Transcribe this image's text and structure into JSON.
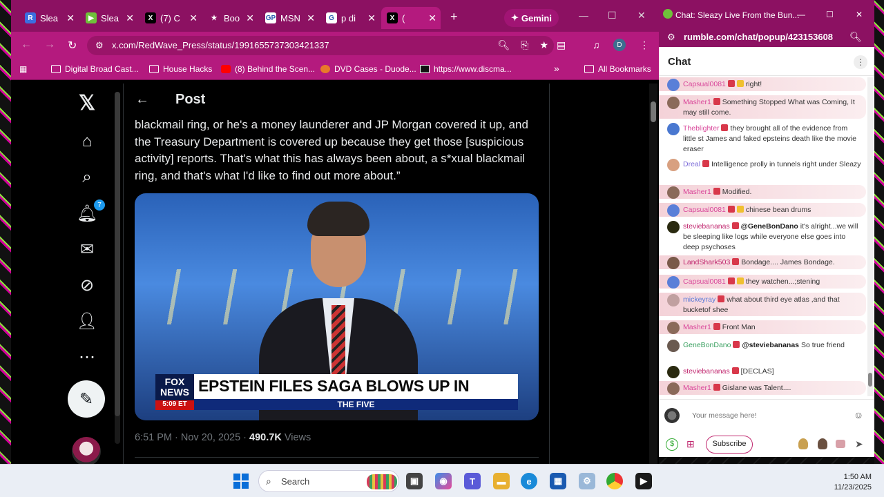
{
  "browser": {
    "tabs": [
      {
        "label": "Slea",
        "icon": "R",
        "color": "#3b6fe0"
      },
      {
        "label": "Slea",
        "icon": "▶",
        "color": "#6fc13a"
      },
      {
        "label": "(7) C",
        "icon": "X",
        "color": "#000000"
      },
      {
        "label": "Boo",
        "icon": "★",
        "color": "transparent"
      },
      {
        "label": "MSN",
        "icon": "GP",
        "color": "#ffffff"
      },
      {
        "label": "p di",
        "icon": "G",
        "color": "#ffffff"
      },
      {
        "label": "(",
        "icon": "X",
        "color": "#000000"
      }
    ],
    "new_tab": "+",
    "gemini_label": "Gemini",
    "url": "x.com/RedWave_Press/status/1991655737303421337",
    "profile_initial": "D",
    "bookmarks": [
      {
        "label": "Digital Broad Cast..."
      },
      {
        "label": "House Hacks"
      },
      {
        "label": "(8) Behind the Scen..."
      },
      {
        "label": "DVD Cases - Duode..."
      },
      {
        "label": "https://www.discma..."
      }
    ],
    "more_bookmarks": "»",
    "all_bookmarks": "All Bookmarks"
  },
  "xpost": {
    "header": "Post",
    "notif_count": "7",
    "text": "blackmail ring, or he's a money launderer and JP Morgan covered it up, and the Treasury Department is covered up because they get those [suspicious activity] reports. That's what this has always been about, a s*xual blackmail ring, and that's what I'd like to find out more about.”",
    "chyron": {
      "logo_line1": "FOX",
      "logo_line2": "NEWS",
      "time": "5:09 ET",
      "headline": "EPSTEIN FILES SAGA BLOWS UP IN DEMS' FACE",
      "show": "THE FIVE"
    },
    "time": "6:51 PM · Nov 20, 2025 · ",
    "views_count": "490.7K",
    "views_label": " Views"
  },
  "chat": {
    "window_title": "Chat: Sleazy Live From the Bun...",
    "url": "rumble.com/chat/popup/423153608",
    "header": "Chat",
    "messages": [
      {
        "user": "Capsual0081",
        "text": "right!",
        "ucolor": "#d9479a",
        "avcolor": "#5a7fd8",
        "hl": true
      },
      {
        "user": "Masher1",
        "text": "Something Stopped What was Coming, It may still come.",
        "ucolor": "#d9479a",
        "avcolor": "#8a6a5a",
        "hl": true
      },
      {
        "user": "Theblighter",
        "text": "they brought all of the evidence from little st James and faked epsteins death like the movie eraser",
        "ucolor": "#d9479a",
        "avcolor": "#4a78d0",
        "hl": false
      },
      {
        "user": "Dreal",
        "text": "Intelligence prolly in tunnels right under Sleazy",
        "ucolor": "#7a6ad8",
        "avcolor": "#d8a080",
        "hl": false
      },
      {
        "user": "Masher1",
        "text": "Modified.",
        "ucolor": "#d9479a",
        "avcolor": "#8a6a5a",
        "hl": true
      },
      {
        "user": "Capsual0081",
        "text": "chinese bean drums",
        "ucolor": "#d9479a",
        "avcolor": "#5a7fd8",
        "hl": true
      },
      {
        "user": "steviebananas",
        "mention": "@GeneBonDano",
        "text": "it's alright...we will be sleeping like logs while everyone else goes into deep psychoses",
        "ucolor": "#c0266e",
        "avcolor": "#2a2a10",
        "hl": false
      },
      {
        "user": "LandShark503",
        "text": "Bondage.... James Bondage.",
        "ucolor": "#c0266e",
        "avcolor": "#7a5a4a",
        "hl": true
      },
      {
        "user": "Capsual0081",
        "text": "they watchen...;stening",
        "ucolor": "#d9479a",
        "avcolor": "#5a7fd8",
        "hl": true
      },
      {
        "user": "mickeyray",
        "text": "what about third eye atlas ,and that bucketof shee",
        "ucolor": "#5a7ad8",
        "avcolor": "#c0a0a0",
        "hl": true
      },
      {
        "user": "Masher1",
        "text": "Front Man",
        "ucolor": "#d9479a",
        "avcolor": "#8a6a5a",
        "hl": true
      },
      {
        "user": "GeneBonDano",
        "mention": "@steviebananas",
        "text": "So true friend",
        "ucolor": "#3aa060",
        "avcolor": "#6a5a50",
        "hl": false
      },
      {
        "user": "steviebananas",
        "text": "[DECLAS]",
        "ucolor": "#c0266e",
        "avcolor": "#2a2a10",
        "hl": false
      },
      {
        "user": "Masher1",
        "text": "Gislane was Talent....",
        "ucolor": "#d9479a",
        "avcolor": "#8a6a5a",
        "hl": true
      }
    ],
    "input_placeholder": "Your message here!",
    "subscribe_label": "Subscribe"
  },
  "taskbar": {
    "search_label": "Search",
    "time": "1:50 AM",
    "date": "11/23/2025"
  }
}
